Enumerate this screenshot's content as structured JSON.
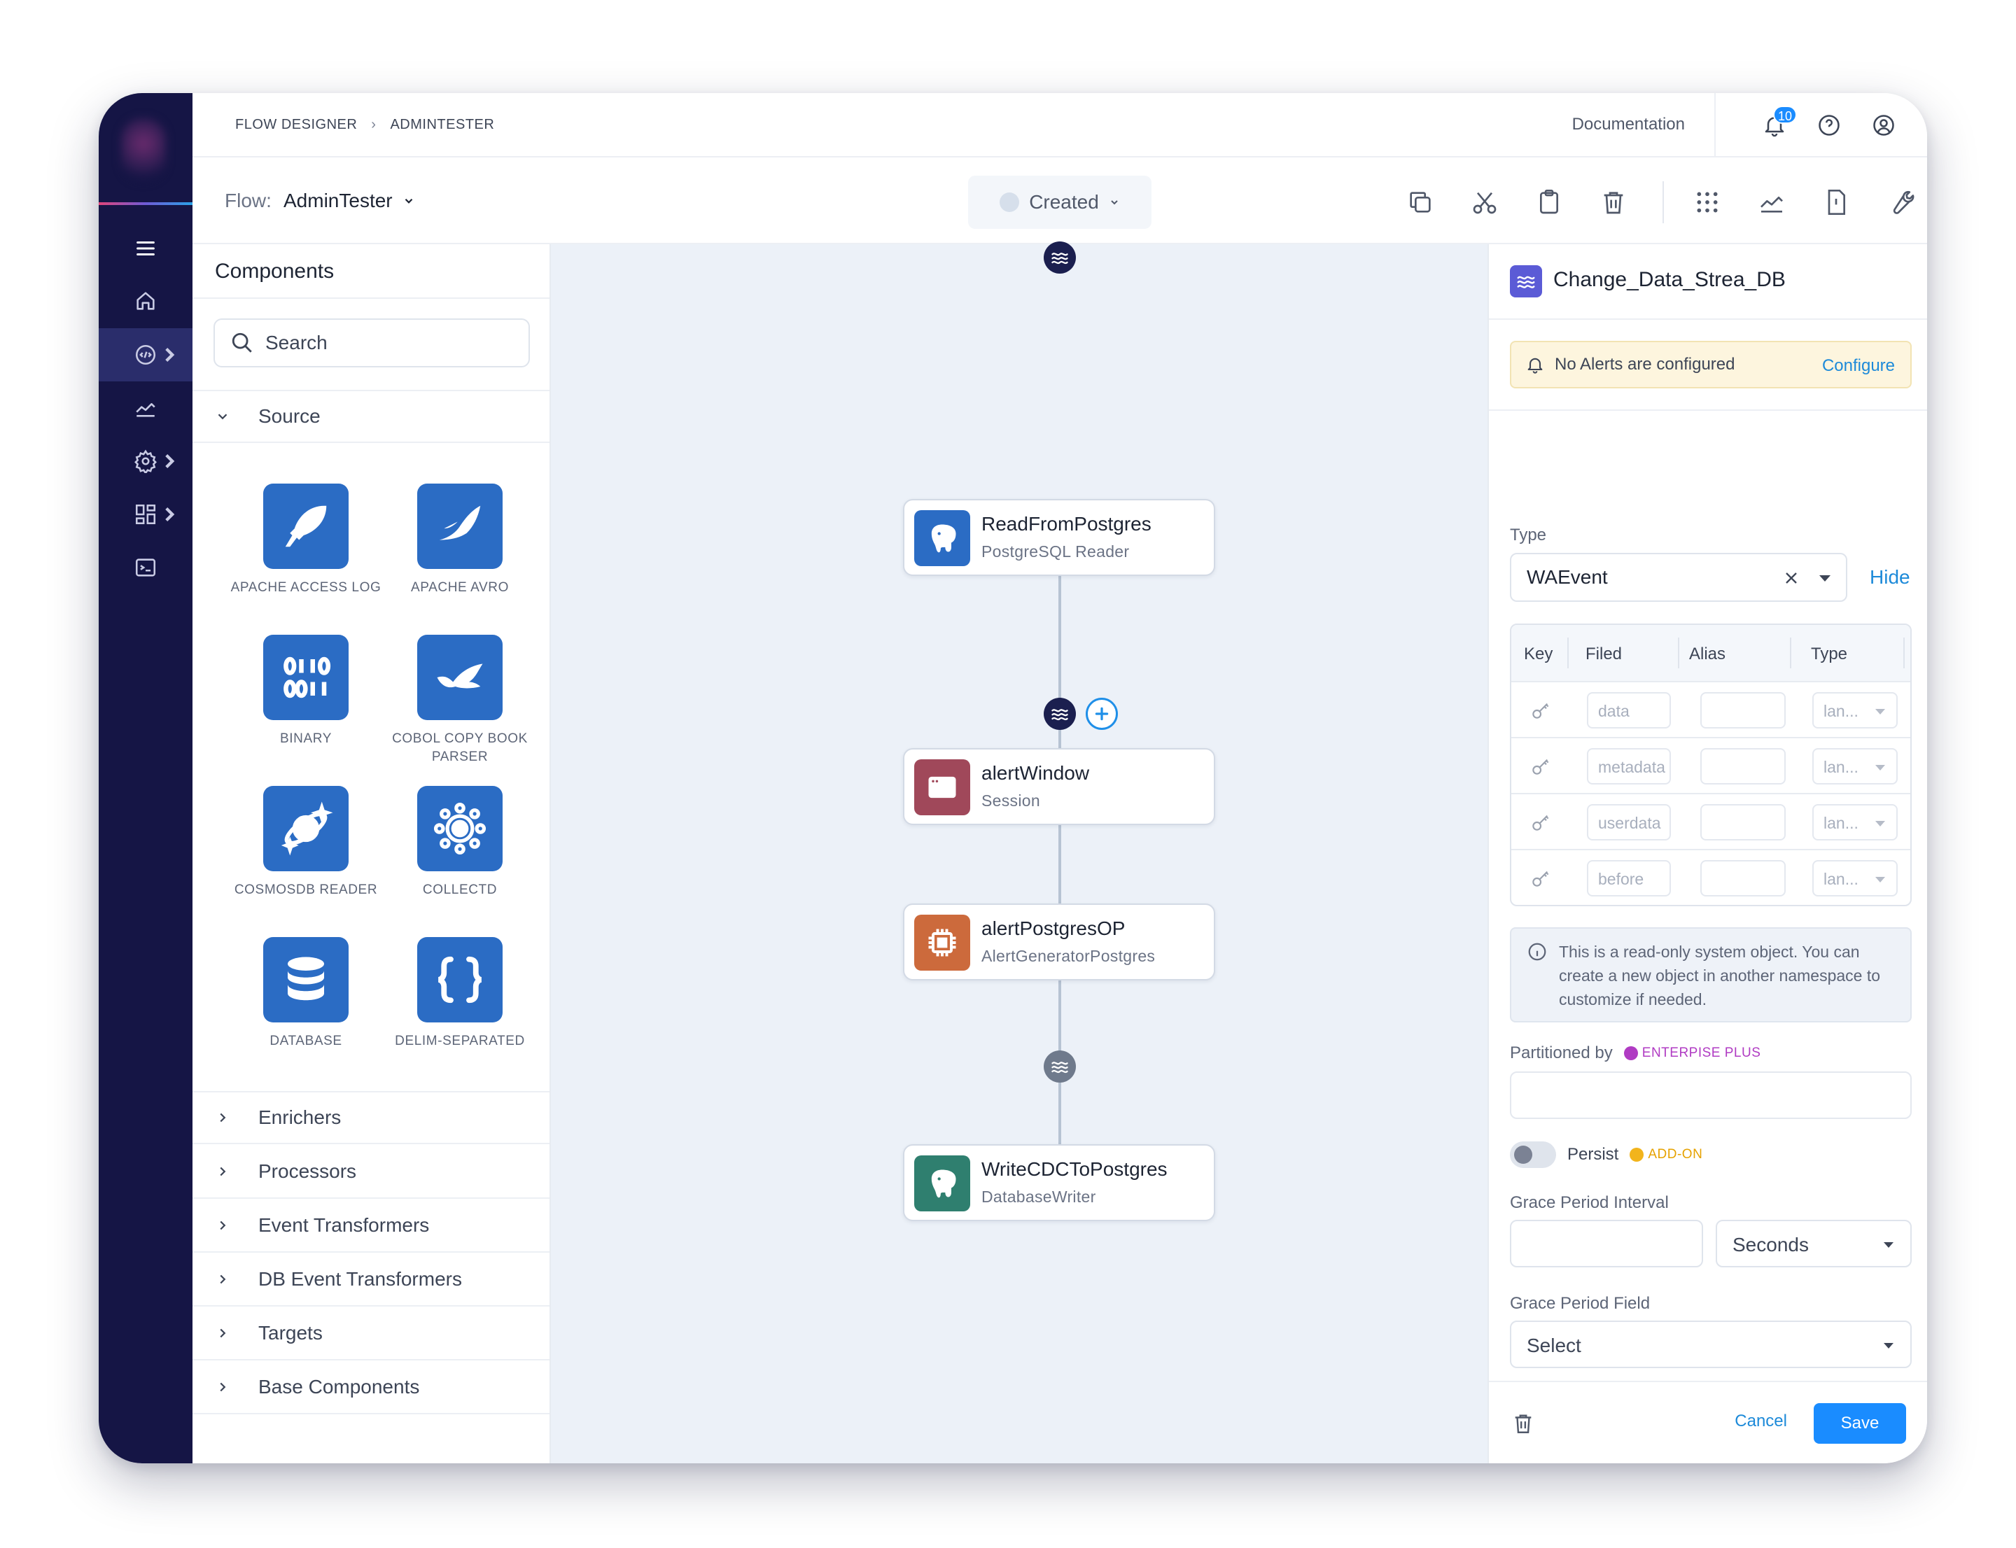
{
  "breadcrumb": {
    "root": "FLOW DESIGNER",
    "separator": "›",
    "current": "ADMINTESTER"
  },
  "header": {
    "documentation": "Documentation",
    "notification_count": "10"
  },
  "toolbar": {
    "flow_label": "Flow:",
    "flow_name": "AdminTester",
    "status": "Created"
  },
  "components": {
    "title": "Components",
    "search_placeholder": "Search",
    "source_label": "Source",
    "source_items": [
      {
        "label": "APACHE ACCESS LOG",
        "icon": "feather-icon"
      },
      {
        "label": "APACHE AVRO",
        "icon": "wing-icon"
      },
      {
        "label": "BINARY",
        "icon": "binary-icon"
      },
      {
        "label": "COBOL COPY BOOK PARSER",
        "icon": "bird-icon"
      },
      {
        "label": "COSMOSDB READER",
        "icon": "planet-icon"
      },
      {
        "label": "COLLECTD",
        "icon": "cluster-icon"
      },
      {
        "label": "DATABASE",
        "icon": "database-icon"
      },
      {
        "label": "DELIM-SEPARATED",
        "icon": "braces-icon"
      }
    ],
    "sections": [
      "Enrichers",
      "Processors",
      "Event Transformers",
      "DB Event Transformers",
      "Targets",
      "Base Components"
    ]
  },
  "canvas": {
    "nodes": [
      {
        "title": "ReadFromPostgres",
        "subtitle": "PostgreSQL Reader",
        "color": "#2b6cc4",
        "icon": "postgres-icon"
      },
      {
        "title": "alertWindow",
        "subtitle": "Session",
        "color": "#a0485a",
        "icon": "window-icon"
      },
      {
        "title": "alertPostgresOP",
        "subtitle": "AlertGeneratorPostgres",
        "color": "#cc6a3c",
        "icon": "chip-icon"
      },
      {
        "title": "WriteCDCToPostgres",
        "subtitle": "DatabaseWriter",
        "color": "#2f7f6f",
        "icon": "postgres-icon"
      }
    ]
  },
  "panel": {
    "title": "Change_Data_Strea_DB",
    "alert_text": "No Alerts are configured",
    "alert_action": "Configure",
    "type_label": "Type",
    "type_value": "WAEvent",
    "hide": "Hide",
    "columns": [
      "Key",
      "Filed",
      "Alias",
      "Type"
    ],
    "rows": [
      {
        "field": "data",
        "type": "lan..."
      },
      {
        "field": "metadata",
        "type": "lan..."
      },
      {
        "field": "userdata",
        "type": "lan..."
      },
      {
        "field": "before",
        "type": "lan..."
      }
    ],
    "info": "This is a read-only system object. You can create a new object in another namespace to customize if needed.",
    "partitioned_label": "Partitioned by",
    "enterprise_badge": "ENTERPISE PLUS",
    "persist_label": "Persist",
    "addon_badge": "ADD-ON",
    "grace_interval_label": "Grace Period Interval",
    "grace_unit": "Seconds",
    "grace_field_label": "Grace Period Field",
    "grace_field_value": "Select",
    "cancel": "Cancel",
    "save": "Save"
  },
  "colors": {
    "rail": "#151545",
    "accent": "#1a8cff",
    "tile": "#2b6cc4",
    "canvas": "#ecf1f8"
  }
}
